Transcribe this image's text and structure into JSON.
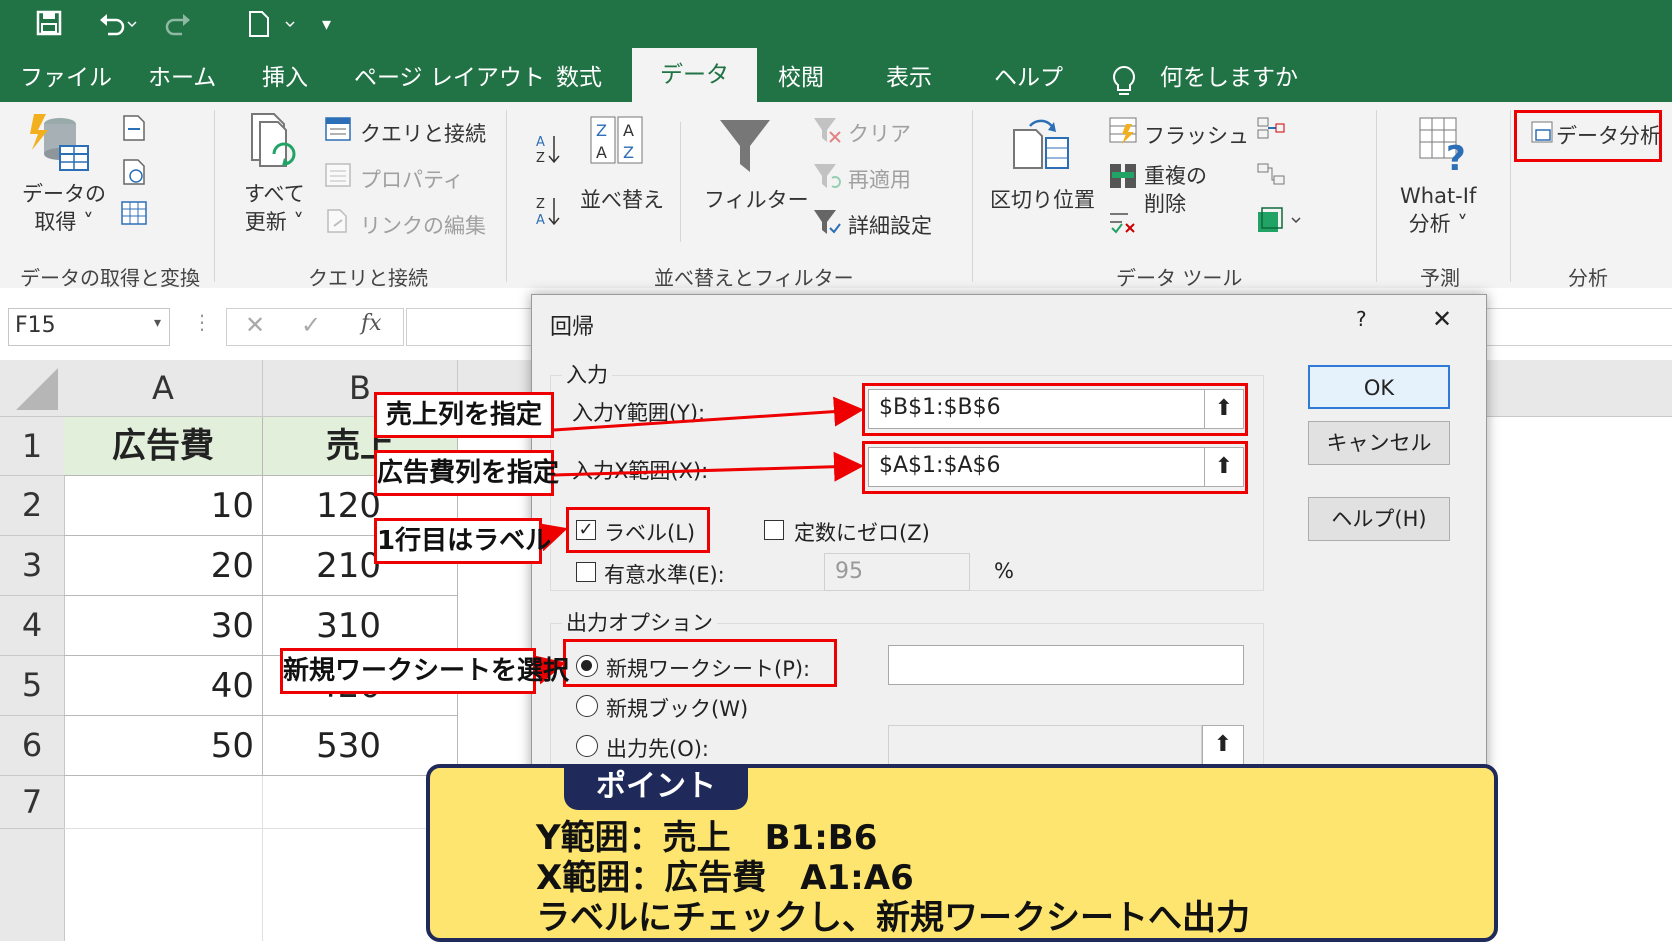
{
  "ribbon_tabs": [
    "ファイル",
    "ホーム",
    "挿入",
    "ページ レイアウト",
    "数式",
    "データ",
    "校閲",
    "表示",
    "ヘルプ"
  ],
  "active_tab": "データ",
  "tell_me": "何をしますか",
  "ribbon": {
    "get_data": "データの\n取得 ˅",
    "refresh_all": "すべて\n更新 ˅",
    "queries_connections": "クエリと接続",
    "properties": "プロパティ",
    "edit_links": "リンクの編集",
    "sort": "並べ替え",
    "filter": "フィルター",
    "clear": "クリア",
    "reapply": "再適用",
    "advanced": "詳細設定",
    "text_to_columns": "区切り位置",
    "flash_fill": "フラッシュ",
    "remove_duplicates": "重複の\n削除",
    "what_if": "What-If\n分析 ˅",
    "data_analysis": "データ分析",
    "groups": {
      "get_transform": "データの取得と変換",
      "queries": "クエリと接続",
      "sort_filter": "並べ替えとフィルター",
      "data_tools": "データ ツール",
      "forecast": "予測",
      "analysis": "分析"
    }
  },
  "name_box": "F15",
  "fx": "fx",
  "columns": [
    "A",
    "B"
  ],
  "rows": [
    "1",
    "2",
    "3",
    "4",
    "5",
    "6",
    "7"
  ],
  "table": {
    "A1": "広告費",
    "B1": "売上",
    "A": [
      "10",
      "20",
      "30",
      "40",
      "50"
    ],
    "B": [
      "120",
      "210",
      "310",
      "420",
      "530"
    ]
  },
  "dialog": {
    "title": "回帰",
    "help_q": "?",
    "close": "✕",
    "input_section": "入力",
    "y_label": "入力Y範囲(Y):",
    "y_value": "$B$1:$B$6",
    "x_label": "入力X範囲(X):",
    "x_value": "$A$1:$A$6",
    "labels": "ラベル(L)",
    "const_zero": "定数にゼロ(Z)",
    "confidence": "有意水準(E):",
    "confidence_value": "95",
    "percent": "%",
    "output_section": "出力オプション",
    "new_sheet": "新規ワークシート(P):",
    "new_book": "新規ブック(W)",
    "output_range": "出力先(O):",
    "ok": "OK",
    "cancel": "キャンセル",
    "help": "ヘルプ(H)"
  },
  "callouts": {
    "sales": "売上列を指定",
    "ad": "広告費列を指定",
    "label": "1行目はラベル",
    "sheet": "新規ワークシートを選択"
  },
  "point": {
    "badge": "ポイント",
    "line1": "Y範囲：売上　B1:B6",
    "line2": "X範囲：広告費　A1:A6",
    "line3": "ラベルにチェックし、新規ワークシートへ出力"
  },
  "colors": {
    "excel_green": "#217346",
    "accent_red": "#e00000",
    "point_yellow": "#fde56f",
    "point_navy": "#1f2a5a"
  }
}
